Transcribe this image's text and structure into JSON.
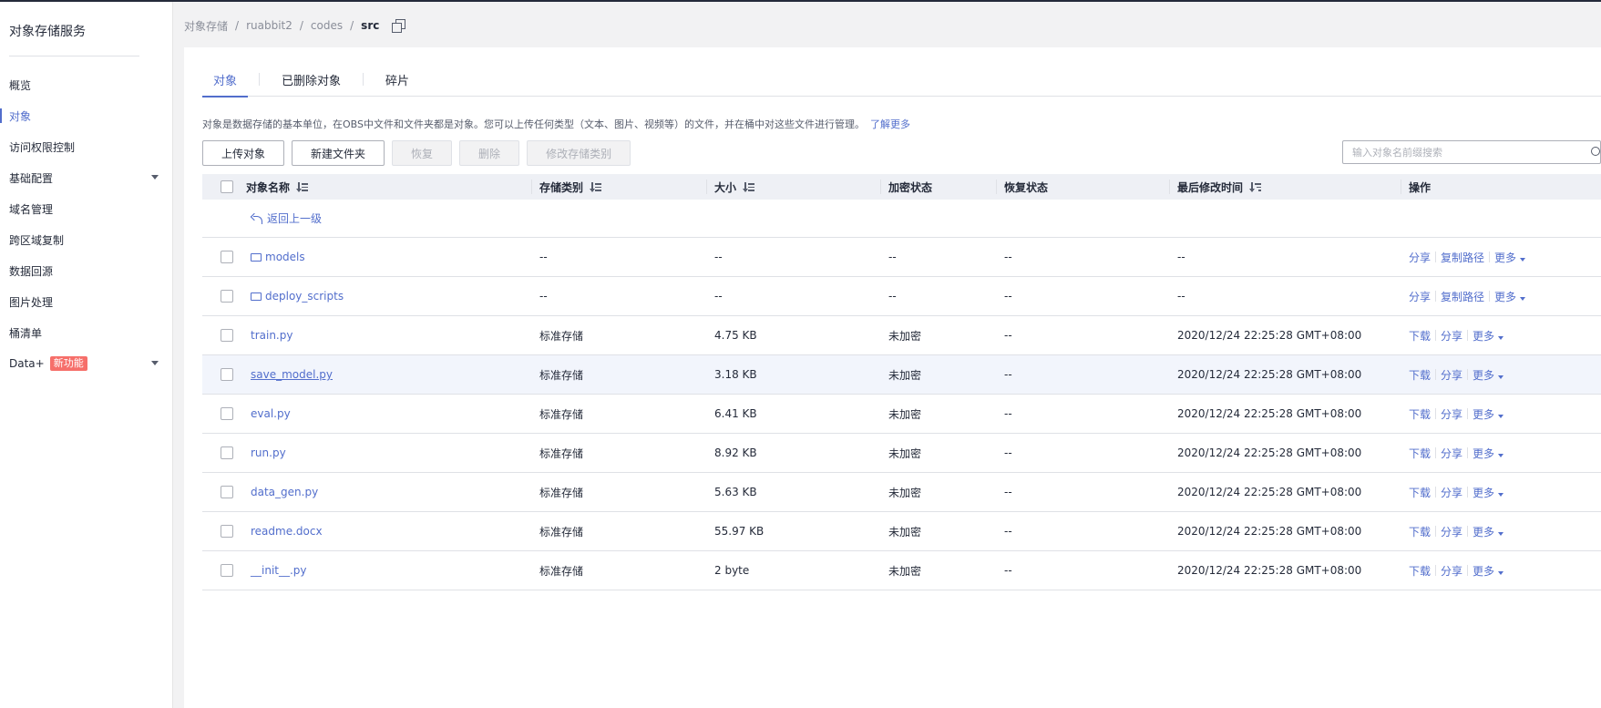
{
  "sidebar": {
    "title": "对象存储服务",
    "items": [
      {
        "label": "概览",
        "active": false
      },
      {
        "label": "对象",
        "active": true
      },
      {
        "label": "访问权限控制",
        "active": false
      },
      {
        "label": "基础配置",
        "active": false,
        "expandable": true
      },
      {
        "label": "域名管理",
        "active": false
      },
      {
        "label": "跨区域复制",
        "active": false
      },
      {
        "label": "数据回源",
        "active": false
      },
      {
        "label": "图片处理",
        "active": false
      },
      {
        "label": "桶清单",
        "active": false
      },
      {
        "label": "Data+",
        "active": false,
        "expandable": true,
        "badge": "新功能"
      }
    ]
  },
  "breadcrumb": {
    "items": [
      "对象存储",
      "ruabbit2",
      "codes"
    ],
    "current": "src"
  },
  "tabs": [
    {
      "label": "对象",
      "active": true
    },
    {
      "label": "已删除对象",
      "active": false
    },
    {
      "label": "碎片",
      "active": false
    }
  ],
  "description": {
    "text": "对象是数据存储的基本单位，在OBS中文件和文件夹都是对象。您可以上传任何类型（文本、图片、视频等）的文件，并在桶中对这些文件进行管理。",
    "link": "了解更多"
  },
  "toolbar": {
    "upload": "上传对象",
    "new_folder": "新建文件夹",
    "restore": "恢复",
    "delete": "删除",
    "change_class": "修改存储类别"
  },
  "search": {
    "placeholder": "输入对象名前缀搜索"
  },
  "table": {
    "headers": {
      "name": "对象名称",
      "storage_class": "存储类别",
      "size": "大小",
      "encryption": "加密状态",
      "restore": "恢复状态",
      "modified": "最后修改时间",
      "actions": "操作"
    },
    "back_label": "返回上一级",
    "action_labels": {
      "download": "下载",
      "share": "分享",
      "copy_path": "复制路径",
      "more": "更多"
    },
    "rows": [
      {
        "name": "models",
        "type": "folder",
        "storage_class": "--",
        "size": "--",
        "encryption": "--",
        "restore": "--",
        "modified": "--"
      },
      {
        "name": "deploy_scripts",
        "type": "folder",
        "storage_class": "--",
        "size": "--",
        "encryption": "--",
        "restore": "--",
        "modified": "--"
      },
      {
        "name": "train.py",
        "type": "file",
        "storage_class": "标准存储",
        "size": "4.75 KB",
        "encryption": "未加密",
        "restore": "--",
        "modified": "2020/12/24 22:25:28 GMT+08:00"
      },
      {
        "name": "save_model.py",
        "type": "file",
        "storage_class": "标准存储",
        "size": "3.18 KB",
        "encryption": "未加密",
        "restore": "--",
        "modified": "2020/12/24 22:25:28 GMT+08:00",
        "hover": true
      },
      {
        "name": "eval.py",
        "type": "file",
        "storage_class": "标准存储",
        "size": "6.41 KB",
        "encryption": "未加密",
        "restore": "--",
        "modified": "2020/12/24 22:25:28 GMT+08:00"
      },
      {
        "name": "run.py",
        "type": "file",
        "storage_class": "标准存储",
        "size": "8.92 KB",
        "encryption": "未加密",
        "restore": "--",
        "modified": "2020/12/24 22:25:28 GMT+08:00"
      },
      {
        "name": "data_gen.py",
        "type": "file",
        "storage_class": "标准存储",
        "size": "5.63 KB",
        "encryption": "未加密",
        "restore": "--",
        "modified": "2020/12/24 22:25:28 GMT+08:00"
      },
      {
        "name": "readme.docx",
        "type": "file",
        "storage_class": "标准存储",
        "size": "55.97 KB",
        "encryption": "未加密",
        "restore": "--",
        "modified": "2020/12/24 22:25:28 GMT+08:00"
      },
      {
        "name": "__init__.py",
        "type": "file",
        "storage_class": "标准存储",
        "size": "2 byte",
        "encryption": "未加密",
        "restore": "--",
        "modified": "2020/12/24 22:25:28 GMT+08:00"
      }
    ]
  },
  "colors": {
    "accent": "#526ecc",
    "badge": "#f66f6a"
  }
}
